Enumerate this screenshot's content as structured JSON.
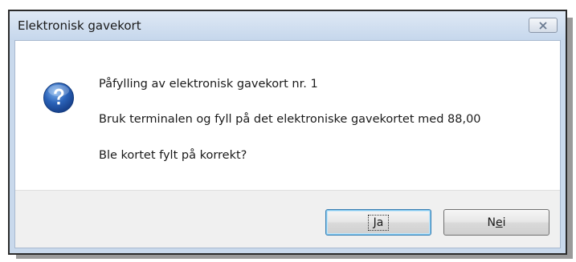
{
  "window": {
    "title": "Elektronisk gavekort"
  },
  "icons": {
    "dialog_icon": "question-icon",
    "close_icon": "close-icon"
  },
  "message": {
    "line1": "Påfylling av elektronisk gavekort nr. 1",
    "line2": "Bruk terminalen og fyll på det elektroniske gavekortet med 88,00",
    "line3": "Ble kortet fylt på korrekt?"
  },
  "buttons": {
    "yes": {
      "label_prefix": "",
      "accelerator": "J",
      "label_rest": "a",
      "default": true
    },
    "no": {
      "label_prefix": "N",
      "accelerator": "e",
      "label_rest": "i",
      "default": false
    }
  },
  "colors": {
    "titlebar": "#c6d7ec",
    "icon_blue": "#2a62b8",
    "default_button_border": "#3c7fb1"
  }
}
